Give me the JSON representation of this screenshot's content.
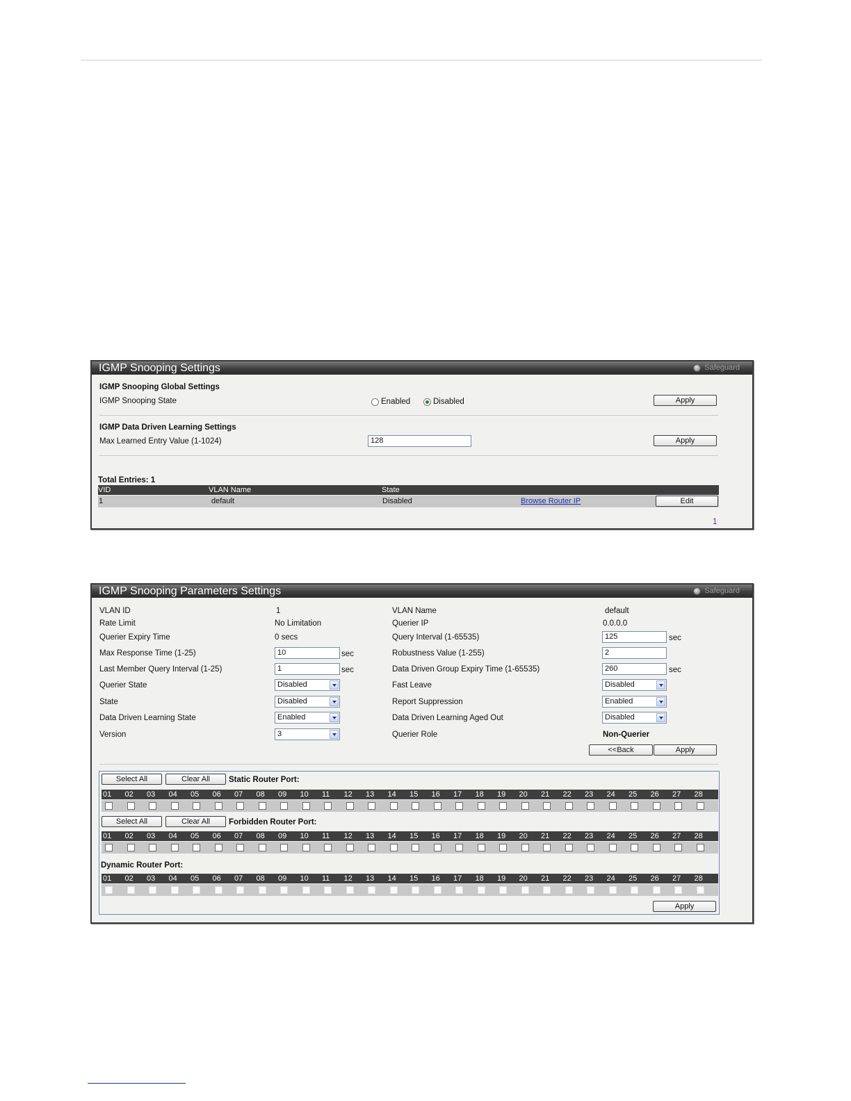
{
  "panel1": {
    "title": "IGMP Snooping Settings",
    "safeguard": "Safeguard",
    "global_heading": "IGMP Snooping Global Settings",
    "state_label": "IGMP Snooping State",
    "radio_enabled": "Enabled",
    "radio_disabled": "Disabled",
    "selected_state": "Disabled",
    "apply_label": "Apply",
    "ddl_heading": "IGMP Data Driven Learning Settings",
    "max_entry_label": "Max Learned Entry Value (1-1024)",
    "max_entry_value": "128",
    "total_entries": "Total Entries: 1",
    "table_headers": [
      "VID",
      "VLAN Name",
      "State"
    ],
    "rows": [
      {
        "vid": "1",
        "vlan_name": "default",
        "state": "Disabled",
        "link": "Browse Router IP",
        "edit": "Edit"
      }
    ],
    "page_number": "1"
  },
  "panel2": {
    "title": "IGMP Snooping Parameters Settings",
    "safeguard": "Safeguard",
    "vlan_id_label": "VLAN ID",
    "vlan_id_value": "1",
    "vlan_name_label": "VLAN Name",
    "vlan_name_value": "default",
    "rate_limit_label": "Rate Limit",
    "rate_limit_value": "No Limitation",
    "querier_ip_label": "Querier IP",
    "querier_ip_value": "0.0.0.0",
    "querier_expiry_label": "Querier Expiry Time",
    "querier_expiry_value": "0 secs",
    "query_interval_label": "Query Interval (1-65535)",
    "query_interval_value": "125",
    "max_response_label": "Max Response Time (1-25)",
    "max_response_value": "10",
    "robustness_label": "Robustness Value (1-255)",
    "robustness_value": "2",
    "last_member_label": "Last Member Query Interval (1-25)",
    "last_member_value": "1",
    "dd_group_expiry_label": "Data Driven Group Expiry Time (1-65535)",
    "dd_group_expiry_value": "260",
    "sec_unit": "sec",
    "querier_state_label": "Querier State",
    "querier_state_value": "Disabled",
    "fast_leave_label": "Fast Leave",
    "fast_leave_value": "Disabled",
    "state_label": "State",
    "state_value": "Disabled",
    "report_suppression_label": "Report Suppression",
    "report_suppression_value": "Enabled",
    "ddl_state_label": "Data Driven Learning State",
    "ddl_state_value": "Enabled",
    "ddl_aged_out_label": "Data Driven Learning Aged Out",
    "ddl_aged_out_value": "Disabled",
    "version_label": "Version",
    "version_value": "3",
    "querier_role_label": "Querier Role",
    "querier_role_value": "Non-Querier",
    "back_label": "<<Back",
    "apply_label": "Apply",
    "select_all_label": "Select All",
    "clear_all_label": "Clear All",
    "static_router_port_label": "Static Router Port:",
    "forbidden_router_port_label": "Forbidden Router Port:",
    "dynamic_router_port_label": "Dynamic Router Port:",
    "ports": [
      "01",
      "02",
      "03",
      "04",
      "05",
      "06",
      "07",
      "08",
      "09",
      "10",
      "11",
      "12",
      "13",
      "14",
      "15",
      "16",
      "17",
      "18",
      "19",
      "20",
      "21",
      "22",
      "23",
      "24",
      "25",
      "26",
      "27",
      "28"
    ],
    "apply_bottom_label": "Apply"
  }
}
